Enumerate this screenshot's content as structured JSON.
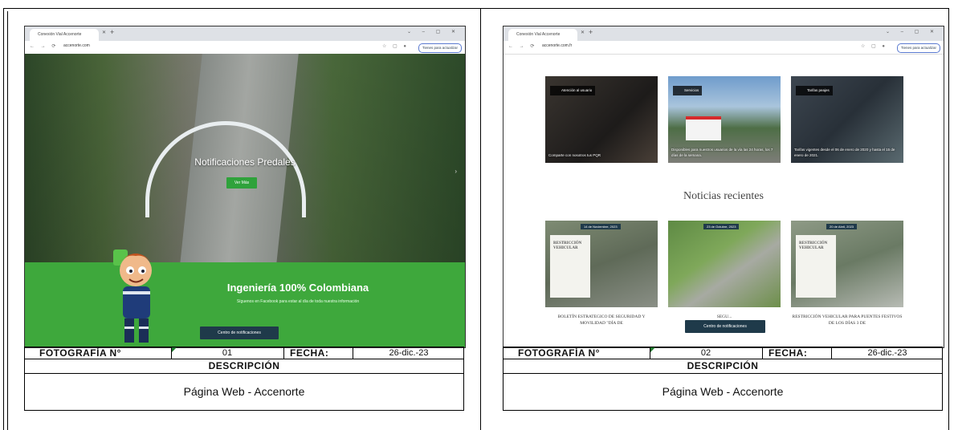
{
  "photos": [
    {
      "browser": {
        "tab_title": "Conexión Vial Accenorte",
        "url": "accenorte.com",
        "update_button": "Tienes para actualizar"
      },
      "hero_title": "Notificaciones Predales",
      "hero_button": "Ver Más",
      "band_title": "Ingeniería 100% Colombiana",
      "band_subtitle": "Síguenos en Facebook para estar al día de toda nuestra información",
      "notif_button": "Centro de notificaciones",
      "label_photo": "FOTOGRAFÍA N°",
      "number": "01",
      "label_date": "FECHA:",
      "date": "26-dic.-23",
      "label_desc": "DESCRIPCIÓN",
      "description": "Página Web - Accenorte"
    },
    {
      "browser": {
        "tab_title": "Conexión Vial Accenorte",
        "url": "accenorte.com.fr",
        "update_button": "Tienes para actualizar"
      },
      "cards": [
        {
          "head": "Atención al usuario",
          "caption": "Comparte con nosotros tus PQR"
        },
        {
          "head": "Servicios",
          "caption": "Disponibles para nuestros usuarios de la vía las 24 horas, los 7 días de la semana."
        },
        {
          "head": "Tarifas peajes",
          "caption": "Tarifas vigentes desde el 06 de enero de 2020 y hasta el 15 de enero de 2021."
        }
      ],
      "news_title": "Noticias recientes",
      "news": [
        {
          "date": "14 de Noviembre, 2023",
          "box": "RESTRICCIÓN VEHICULAR",
          "caption": "BOLETÍN ESTRATEGICO DE SEGURIDAD Y MOVILIDAD \"DÍA DE"
        },
        {
          "date": "23 de Octubre, 2023",
          "box": "",
          "caption": "SEGU..."
        },
        {
          "date": "20 de Abril, 2023",
          "box": "RESTRICCIÓN VEHICULAR",
          "caption": "RESTRICCIÓN VEHICULAR PARA PUENTES FESTIVOS DE LOS DÍAS 3 DE"
        }
      ],
      "notif_button": "Centro de notificaciones",
      "label_photo": "FOTOGRAFÍA N°",
      "number": "02",
      "label_date": "FECHA:",
      "date": "26-dic.-23",
      "label_desc": "DESCRIPCIÓN",
      "description": "Página Web - Accenorte"
    }
  ]
}
